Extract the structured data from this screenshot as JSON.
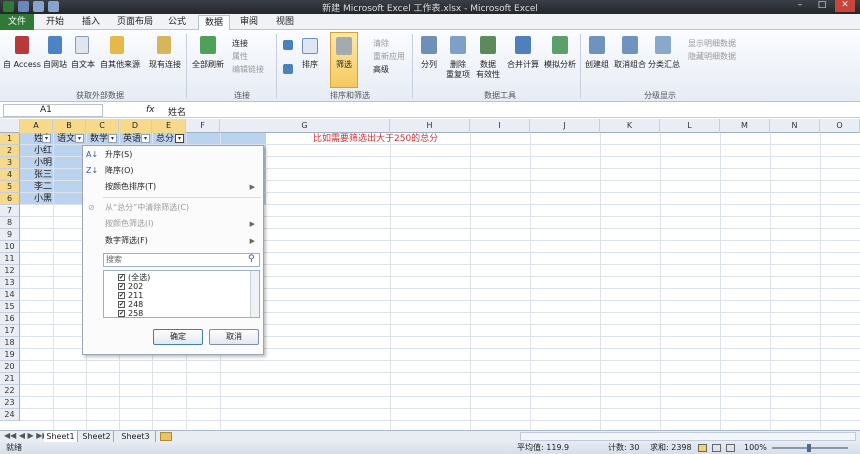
{
  "titlebar": {
    "title": "新建 Microsoft Excel 工作表.xlsx - Microsoft Excel",
    "min": "–",
    "max": "□",
    "close": "✕"
  },
  "tabs": {
    "file": "文件",
    "home": "开始",
    "insert": "插入",
    "layout": "页面布局",
    "formulas": "公式",
    "data": "数据",
    "review": "审阅",
    "view": "视图"
  },
  "ribbon": {
    "get_external": {
      "access": "自 Access",
      "web": "自网站",
      "text": "自文本",
      "other1": "自其他来源",
      "existing": "现有连接",
      "label": "获取外部数据"
    },
    "connections": {
      "refresh_all": "全部刷新",
      "connections": "连接",
      "properties": "属性",
      "edit_links": "编辑链接",
      "label": "连接"
    },
    "sort_filter": {
      "sort": "排序",
      "filter": "筛选",
      "clear": "清除",
      "reapply": "重新应用",
      "advanced": "高级",
      "label": "排序和筛选"
    },
    "data_tools": {
      "split": "分列",
      "remove_dup_1": "删除",
      "remove_dup_2": "重复项",
      "validation_1": "数据",
      "validation_2": "有效性",
      "consolidate": "合并计算",
      "whatif": "模拟分析",
      "label": "数据工具"
    },
    "outline": {
      "group": "创建组",
      "ungroup": "取消组合",
      "subtotal": "分类汇总",
      "show_detail": "显示明细数据",
      "hide_detail": "隐藏明细数据",
      "label": "分级显示"
    }
  },
  "formula": {
    "namebox": "A1",
    "fx": "fx",
    "content": "姓名"
  },
  "columns": [
    "A",
    "B",
    "C",
    "D",
    "E",
    "F",
    "G",
    "H",
    "I",
    "J",
    "K",
    "L",
    "M",
    "N",
    "O"
  ],
  "rows": [
    "1",
    "2",
    "3",
    "4",
    "5",
    "6",
    "7",
    "8",
    "9",
    "10",
    "11",
    "12",
    "13",
    "14",
    "15",
    "16",
    "17",
    "18",
    "19",
    "20",
    "21",
    "22",
    "23",
    "24"
  ],
  "table": {
    "headers": [
      "姓名",
      "语文",
      "数学",
      "英语",
      "总分"
    ],
    "names": [
      "小红",
      "小明",
      "张三",
      "李二",
      "小黑"
    ]
  },
  "note": "比如需要筛选出大于250的总分",
  "filter_menu": {
    "sort_asc": "升序(S)",
    "sort_desc": "降序(O)",
    "sort_color": "按颜色排序(T)",
    "clear_filter": "从“总分”中清除筛选(C)",
    "color_filter": "按颜色筛选(I)",
    "number_filter": "数字筛选(F)",
    "search_placeholder": "搜索",
    "items": [
      "(全选)",
      "202",
      "211",
      "248",
      "258"
    ],
    "ok": "确定",
    "cancel": "取消"
  },
  "sheets": [
    "Sheet1",
    "Sheet2",
    "Sheet3"
  ],
  "status": {
    "ready": "就绪",
    "average": "平均值: 119.9",
    "count": "计数: 30",
    "sum": "求和: 2398",
    "zoom": "100%"
  }
}
